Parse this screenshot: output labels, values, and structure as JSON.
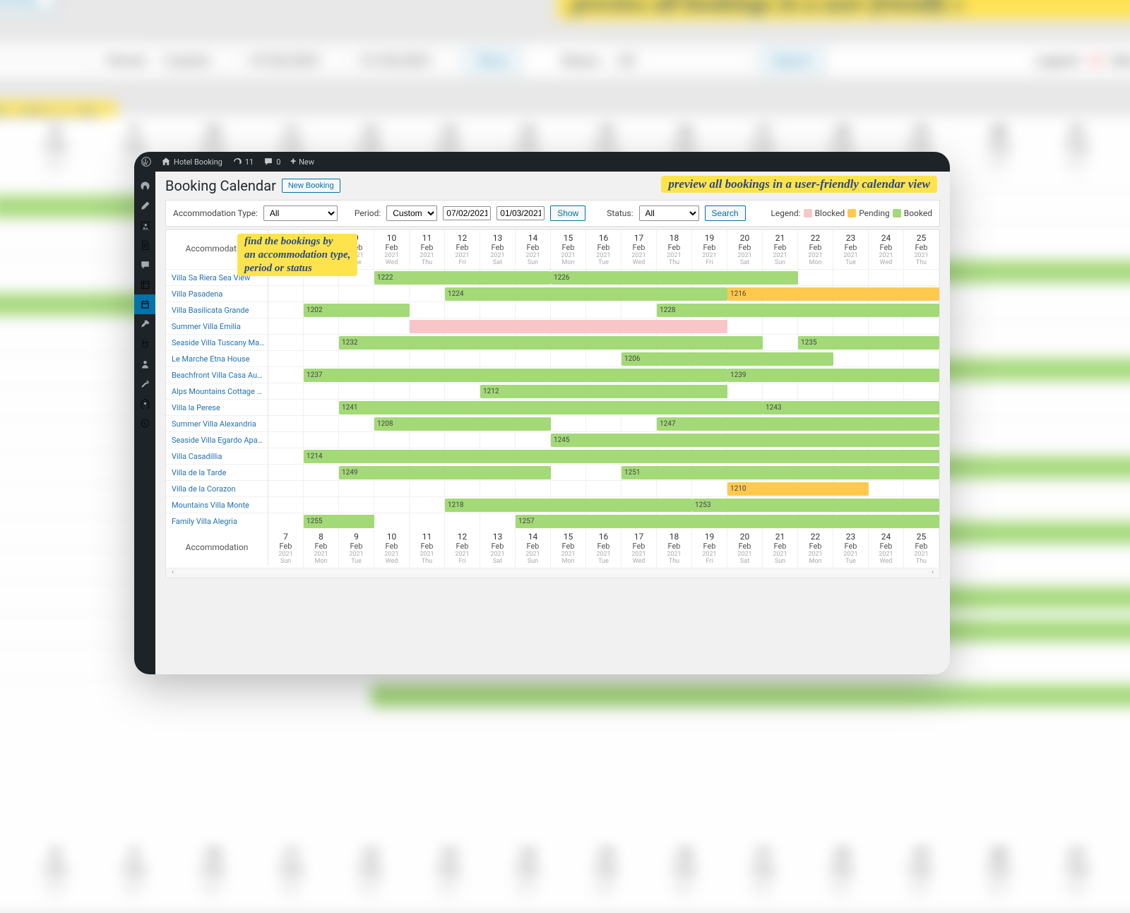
{
  "admin_bar": {
    "site_name": "Hotel Booking",
    "updates": "11",
    "comments": "0",
    "new_label": "New"
  },
  "page": {
    "title": "Booking Calendar",
    "new_booking": "New Booking"
  },
  "annotations": {
    "top": "preview all bookings in a user-friendly calendar view",
    "mid_l1": "find the bookings by",
    "mid_l2": "an accommodation type,",
    "mid_l3": "period or status",
    "bg_top": "preview all bookings in a user-friendly c",
    "bg_left_l1": "d the bookings by",
    "bg_left_l2": "accomm",
    "bg_left_l3": "iod or st"
  },
  "filters": {
    "accom_label": "Accommodation Type:",
    "accom_value": "All",
    "period_label": "Period:",
    "period_value": "Custom",
    "date_from": "07/02/2021",
    "date_to": "01/03/2021",
    "show_btn": "Show",
    "status_label": "Status:",
    "status_value": "All",
    "search_btn": "Search"
  },
  "legend": {
    "label": "Legend:",
    "blocked": "Blocked",
    "pending": "Pending",
    "booked": "Booked",
    "color_blocked": "#f8c6c6",
    "color_pending": "#ffc94d",
    "color_booked": "#a3d977"
  },
  "dates": [
    {
      "d": "7",
      "m": "Feb",
      "y": "2021",
      "w": "Sun"
    },
    {
      "d": "8",
      "m": "Feb",
      "y": "2021",
      "w": "Mon"
    },
    {
      "d": "9",
      "m": "Feb",
      "y": "2021",
      "w": "Tue"
    },
    {
      "d": "10",
      "m": "Feb",
      "y": "2021",
      "w": "Wed"
    },
    {
      "d": "11",
      "m": "Feb",
      "y": "2021",
      "w": "Thu"
    },
    {
      "d": "12",
      "m": "Feb",
      "y": "2021",
      "w": "Fri"
    },
    {
      "d": "13",
      "m": "Feb",
      "y": "2021",
      "w": "Sat"
    },
    {
      "d": "14",
      "m": "Feb",
      "y": "2021",
      "w": "Sun"
    },
    {
      "d": "15",
      "m": "Feb",
      "y": "2021",
      "w": "Mon"
    },
    {
      "d": "16",
      "m": "Feb",
      "y": "2021",
      "w": "Tue"
    },
    {
      "d": "17",
      "m": "Feb",
      "y": "2021",
      "w": "Wed"
    },
    {
      "d": "18",
      "m": "Feb",
      "y": "2021",
      "w": "Thu"
    },
    {
      "d": "19",
      "m": "Feb",
      "y": "2021",
      "w": "Fri"
    },
    {
      "d": "20",
      "m": "Feb",
      "y": "2021",
      "w": "Sat"
    },
    {
      "d": "21",
      "m": "Feb",
      "y": "2021",
      "w": "Sun"
    },
    {
      "d": "22",
      "m": "Feb",
      "y": "2021",
      "w": "Mon"
    },
    {
      "d": "23",
      "m": "Feb",
      "y": "2021",
      "w": "Tue"
    },
    {
      "d": "24",
      "m": "Feb",
      "y": "2021",
      "w": "Wed"
    },
    {
      "d": "25",
      "m": "Feb",
      "y": "2021",
      "w": "Thu"
    }
  ],
  "accom_header": "Accommodation",
  "rows": [
    {
      "name": "Villa Sa Riera Sea View",
      "bars": [
        {
          "start": 3,
          "span": 5,
          "status": "booked",
          "label": "1222"
        },
        {
          "start": 8,
          "span": 7,
          "status": "booked",
          "label": "1226"
        }
      ]
    },
    {
      "name": "Villa Pasadena",
      "bars": [
        {
          "start": 5,
          "span": 8,
          "status": "booked",
          "label": "1224"
        },
        {
          "start": 13,
          "span": 6,
          "status": "pending",
          "label": "1216"
        }
      ]
    },
    {
      "name": "Villa Basilicata Grande",
      "bars": [
        {
          "start": 1,
          "span": 3,
          "status": "booked",
          "label": "1202"
        },
        {
          "start": 11,
          "span": 8,
          "status": "booked",
          "label": "1228"
        }
      ]
    },
    {
      "name": "Summer Villa Emilia",
      "bars": [
        {
          "start": 4,
          "span": 9,
          "status": "blocked",
          "label": ""
        }
      ]
    },
    {
      "name": "Seaside Villa Tuscany Ma…",
      "bars": [
        {
          "start": 2,
          "span": 12,
          "status": "booked",
          "label": "1232"
        },
        {
          "start": 15,
          "span": 4,
          "status": "booked",
          "label": "1235"
        }
      ]
    },
    {
      "name": "Le Marche Etna House",
      "bars": [
        {
          "start": 10,
          "span": 6,
          "status": "booked",
          "label": "1206"
        }
      ]
    },
    {
      "name": "Beachfront Villa Casa Au…",
      "bars": [
        {
          "start": 1,
          "span": 12,
          "status": "booked",
          "label": "1237"
        },
        {
          "start": 13,
          "span": 6,
          "status": "booked",
          "label": "1239"
        }
      ]
    },
    {
      "name": "Alps Mountains Cottage …",
      "bars": [
        {
          "start": 6,
          "span": 7,
          "status": "booked",
          "label": "1212"
        }
      ]
    },
    {
      "name": "Villa la Perese",
      "bars": [
        {
          "start": 2,
          "span": 12,
          "status": "booked",
          "label": "1241"
        },
        {
          "start": 14,
          "span": 5,
          "status": "booked",
          "label": "1243"
        }
      ]
    },
    {
      "name": "Summer Villa Alexandria",
      "bars": [
        {
          "start": 3,
          "span": 5,
          "status": "booked",
          "label": "1208"
        },
        {
          "start": 11,
          "span": 8,
          "status": "booked",
          "label": "1247"
        }
      ]
    },
    {
      "name": "Seaside Villa Egardo Apa…",
      "bars": [
        {
          "start": 8,
          "span": 11,
          "status": "booked",
          "label": "1245"
        }
      ]
    },
    {
      "name": "Villa Casadillia",
      "bars": [
        {
          "start": 1,
          "span": 18,
          "status": "booked",
          "label": "1214"
        }
      ]
    },
    {
      "name": "Villa de la Tarde",
      "bars": [
        {
          "start": 2,
          "span": 6,
          "status": "booked",
          "label": "1249"
        },
        {
          "start": 10,
          "span": 9,
          "status": "booked",
          "label": "1251"
        }
      ]
    },
    {
      "name": "Villa de la Corazon",
      "bars": [
        {
          "start": 13,
          "span": 4,
          "status": "pending",
          "label": "1210"
        }
      ]
    },
    {
      "name": "Mountains Villa Monte",
      "bars": [
        {
          "start": 5,
          "span": 7,
          "status": "booked",
          "label": "1218"
        },
        {
          "start": 12,
          "span": 7,
          "status": "booked",
          "label": "1253"
        }
      ]
    },
    {
      "name": "Family Villa Alegria",
      "bars": [
        {
          "start": 1,
          "span": 2,
          "status": "booked",
          "label": "1255"
        },
        {
          "start": 7,
          "span": 12,
          "status": "booked",
          "label": "1257"
        }
      ]
    }
  ],
  "bg_filters": {
    "period": "Period:",
    "custom": "Custom",
    "d1": "07/02/2021",
    "d2": "01/03/2021",
    "show": "Show",
    "status": "Status:",
    "all": "All",
    "search": "Search",
    "legend": "Legend:",
    "blocked": "Blocked"
  }
}
